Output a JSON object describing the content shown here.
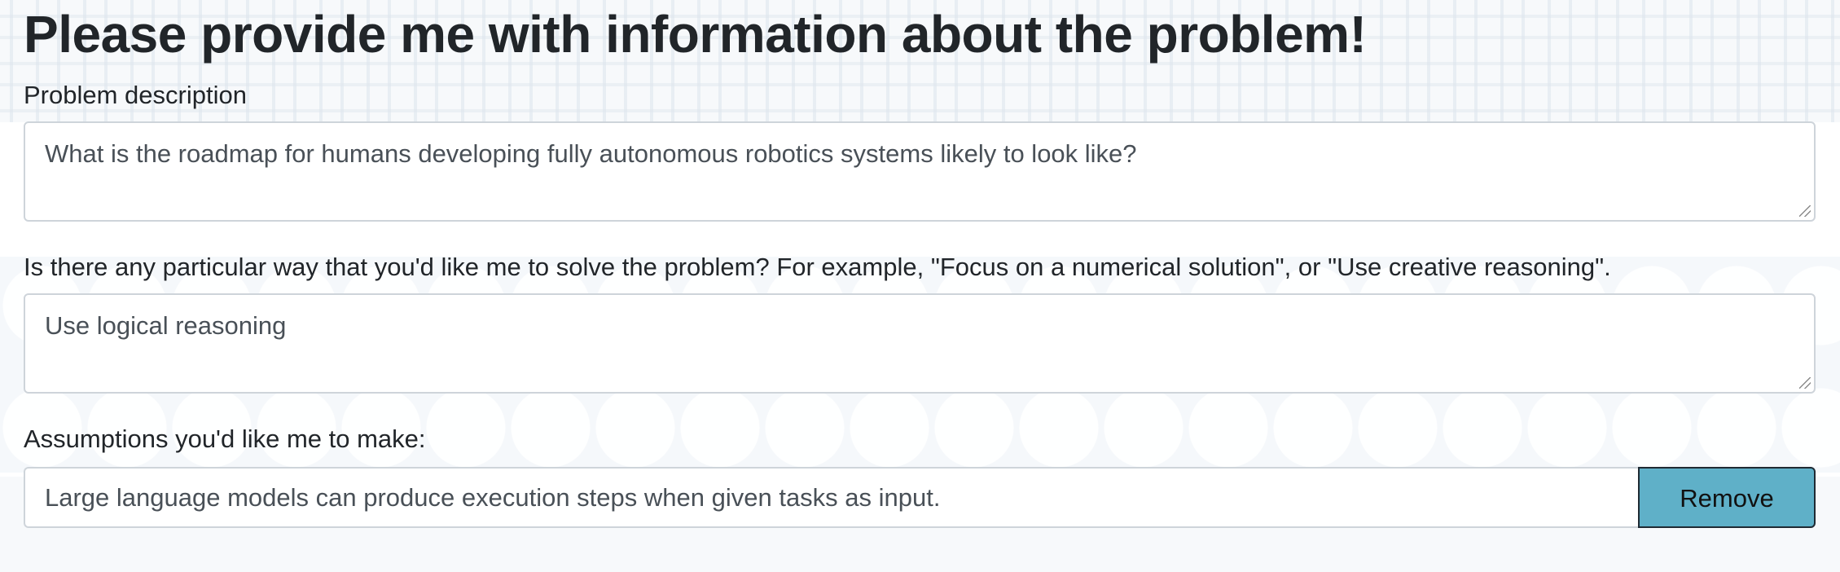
{
  "page": {
    "title": "Please provide me with information about the problem!"
  },
  "problem": {
    "label": "Problem description",
    "value": "What is the roadmap for humans developing fully autonomous robotics systems likely to look like?"
  },
  "approach": {
    "label": "Is there any particular way that you'd like me to solve the problem? For example, \"Focus on a numerical solution\", or \"Use creative reasoning\".",
    "value": "Use logical reasoning"
  },
  "assumptions": {
    "label": "Assumptions you'd like me to make:",
    "items": [
      {
        "value": "Large language models can produce execution steps when given tasks as input.",
        "remove_label": "Remove"
      }
    ]
  },
  "colors": {
    "remove_button": "#5fb0c8",
    "text": "#212529",
    "field_text": "#495057",
    "field_border": "#ced4da"
  }
}
